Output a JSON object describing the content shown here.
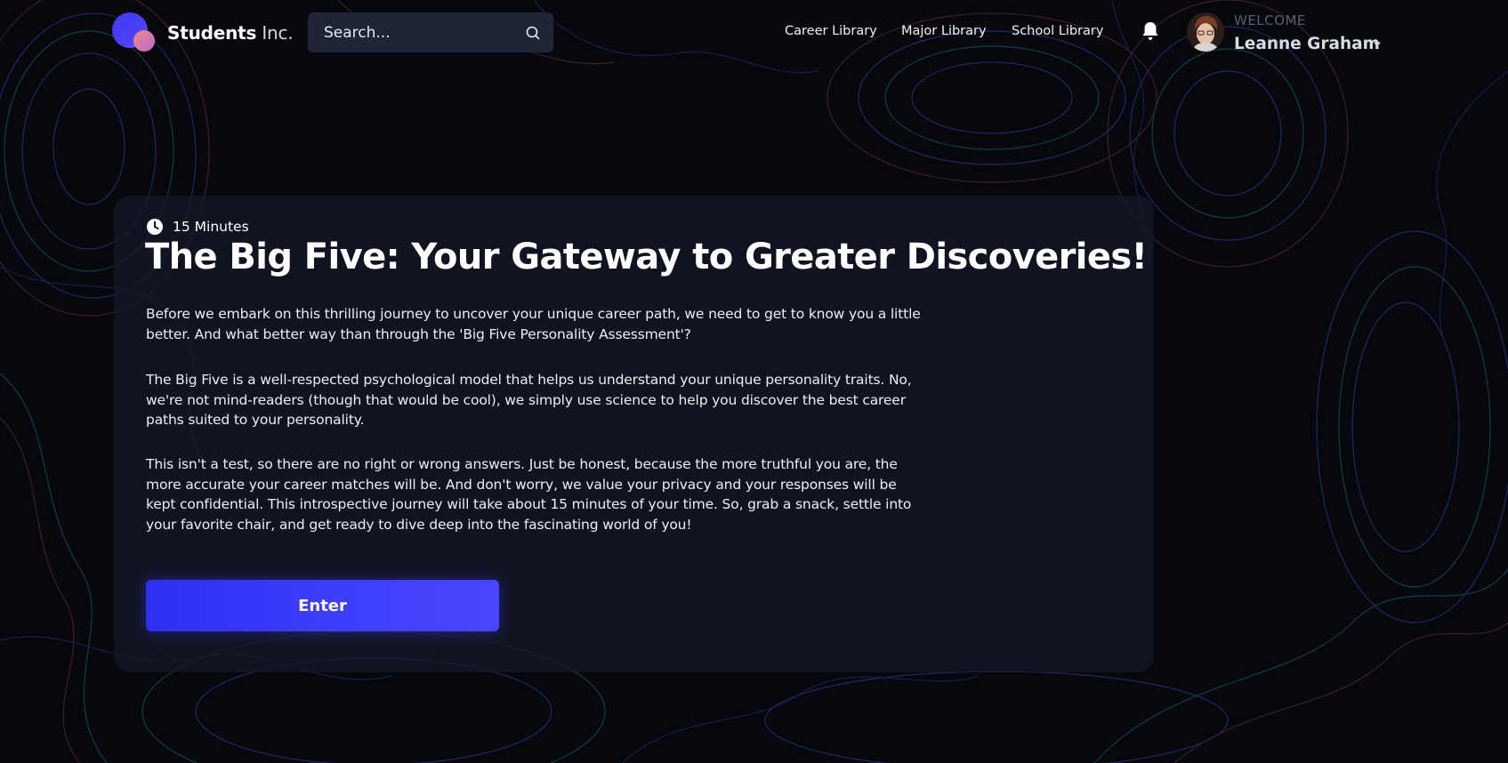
{
  "brand": {
    "name": "Students",
    "suffix": " Inc."
  },
  "search": {
    "placeholder": "Search..."
  },
  "nav": {
    "items": [
      {
        "label": "Career Library"
      },
      {
        "label": "Major Library"
      },
      {
        "label": "School Library"
      }
    ]
  },
  "user": {
    "welcome": "WELCOME",
    "name": "Leanne Graham"
  },
  "assessment": {
    "duration": "15 Minutes",
    "title": "The Big Five: Your Gateway to Greater Discoveries!",
    "paragraphs": [
      "Before we embark on this thrilling journey to uncover your unique career path, we need to get to know you a little better. And what better way than through the 'Big Five Personality Assessment'?",
      "The Big Five is a well-respected psychological model that helps us understand your unique personality traits. No, we're not mind-readers (though that would be cool), we simply use science to help you discover the best career paths suited to your personality.",
      "This isn't a test, so there are no right or wrong answers. Just be honest, because the more truthful you are, the more accurate your career matches will be. And don't worry, we value your privacy and your responses will be kept confidential. This introspective journey will take about 15 minutes of your time. So, grab a snack, settle into your favorite chair, and get ready to dive deep into the fascinating world of you!"
    ],
    "enter_label": "Enter"
  },
  "icons": {
    "search": "search-icon",
    "notifications": "bell-icon",
    "duration": "clock-icon",
    "user_menu": "caret-down-icon"
  },
  "colors": {
    "background": "#07080d",
    "card": "#141826",
    "search_bg": "#1f2437",
    "accent": "#3d3dfb",
    "logo_primary": "#4b3ff5",
    "logo_secondary": "#f08a7a"
  }
}
